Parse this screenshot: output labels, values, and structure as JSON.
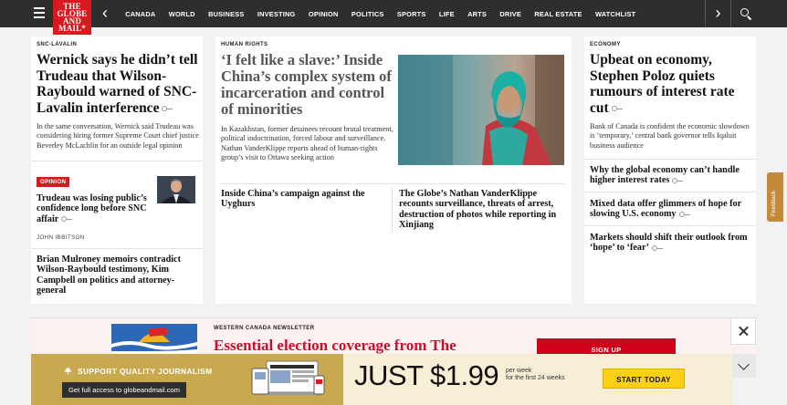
{
  "nav": {
    "logo_lines": [
      "THE",
      "GLOBE",
      "AND",
      "MAIL*"
    ],
    "items": [
      "CANADA",
      "WORLD",
      "BUSINESS",
      "INVESTING",
      "OPINION",
      "POLITICS",
      "SPORTS",
      "LIFE",
      "ARTS",
      "DRIVE",
      "REAL ESTATE",
      "WATCHLIST"
    ],
    "prev": "‹",
    "next": "›"
  },
  "left_col": {
    "lead": {
      "kicker": "SNC-LAVALIN",
      "headline": "Wernick says he didn’t tell Trudeau that Wilson-Raybould warned of SNC-Lavalin interference",
      "summary": "In the same conversation, Wernick said Trudeau was considering hiring former Supreme Court chief justice Beverley McLachlin for an outside legal opinion"
    },
    "opinion": {
      "tag": "OPINION",
      "headline": "Trudeau was losing public’s confidence long before SNC affair",
      "author": "JOHN IBBITSON"
    },
    "story3": {
      "headline": "Brian Mulroney memoirs contradict Wilson-Raybould testimony, Kim Campbell on politics and attorney-general"
    }
  },
  "center_col": {
    "kicker": "HUMAN RIGHTS",
    "headline": "‘I felt like a slave:’ Inside China’s complex system of incarceration and control of minorities",
    "summary": "In Kazakhstan, former detainees recount brutal treatment, political indoctrination, forced labour and surveillance. Nathan VanderKlippe reports ahead of human-rights group’s visit to Ottawa seeking action",
    "related": [
      "Inside China’s campaign against the Uyghurs",
      "The Globe’s Nathan VanderKlippe recounts surveillance, threats of arrest, destruction of photos while reporting in Xinjiang"
    ]
  },
  "right_col": {
    "kicker": "ECONOMY",
    "headline": "Upbeat on economy, Stephen Poloz quiets rumours of interest rate cut",
    "summary": "Bank of Canada is confident the economic slowdown is ‘temporary,’ central bank governor tells Iqaluit business audience",
    "more": [
      "Why the global economy can’t handle higher interest rates",
      "Mixed data offer glimmers of hope for slowing U.S. economy",
      "Markets should shift their outlook from ‘hope’ to ‘fear’"
    ]
  },
  "newsletter": {
    "kicker": "WESTERN CANADA NEWSLETTER",
    "title": "Essential election coverage from The",
    "signup": "SIGN UP"
  },
  "subscribe": {
    "support": "SUPPORT QUALITY JOURNALISM",
    "link": "Get full access to globeandmail.com",
    "price": "JUST $1.99",
    "per_line1": "per week",
    "per_line2": "for the first 24 weeks",
    "cta": "START TODAY"
  },
  "feedback": "Feedback",
  "colors": {
    "brand_red": "#d71920",
    "nav_bg": "#2e2e2e",
    "cta_yellow": "#fcd015",
    "sub_gold": "#c9a94f"
  }
}
